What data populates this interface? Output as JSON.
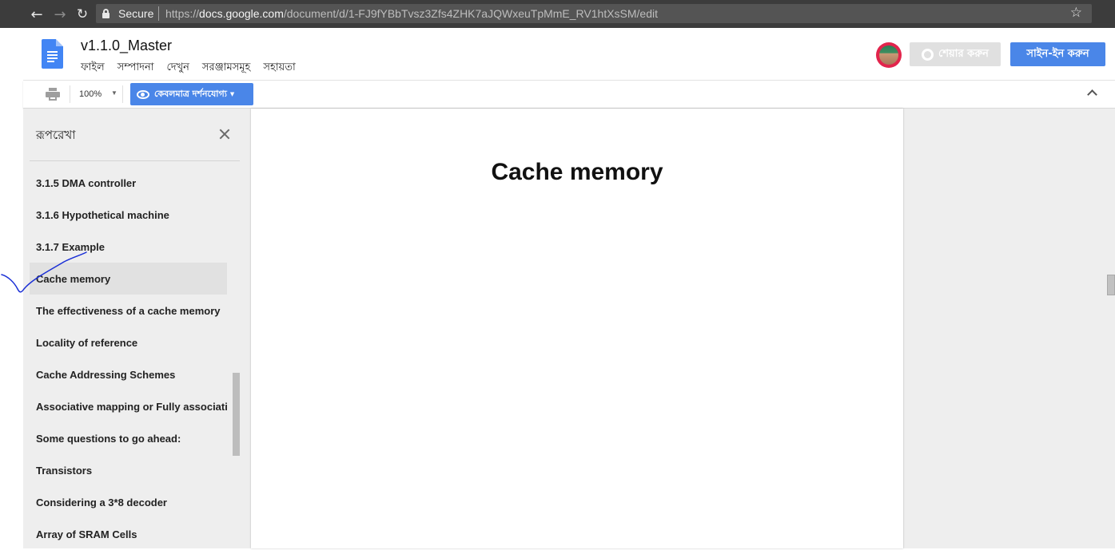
{
  "browser": {
    "secure_label": "Secure",
    "url_scheme": "https://",
    "url_host": "docs.google.com",
    "url_path": "/document/d/1-FJ9fYBbTvsz3Zfs4ZHK7aJQWxeuTpMmE_RV1htXsSM/edit"
  },
  "docs": {
    "title": "v1.1.0_Master",
    "menu": [
      "ফাইল",
      "সম্পাদনা",
      "দেখুন",
      "সরঞ্জামসমূহ",
      "সহায়তা"
    ],
    "share_label": "শেয়ার করুন",
    "signin_label": "সাইন-ইন করুন",
    "accent_color": "#4a86e8"
  },
  "toolbar": {
    "zoom": "100%",
    "view_mode_label": "কেবলমাত্র দর্শনযোগ্য"
  },
  "outline": {
    "title": "রূপরেখা",
    "items": [
      "3.1.5 DMA controller",
      "3.1.6 Hypothetical machine",
      "3.1.7 Example",
      "Cache memory",
      "The effectiveness of a cache memory",
      "Locality of reference",
      "Cache Addressing Schemes",
      "Associative mapping or Fully associative mapping",
      "Some questions to go ahead:",
      "Transistors",
      "Considering a 3*8 decoder",
      "Array of SRAM Cells"
    ],
    "active_item": "Cache memory"
  },
  "document": {
    "heading": "Cache memory"
  }
}
